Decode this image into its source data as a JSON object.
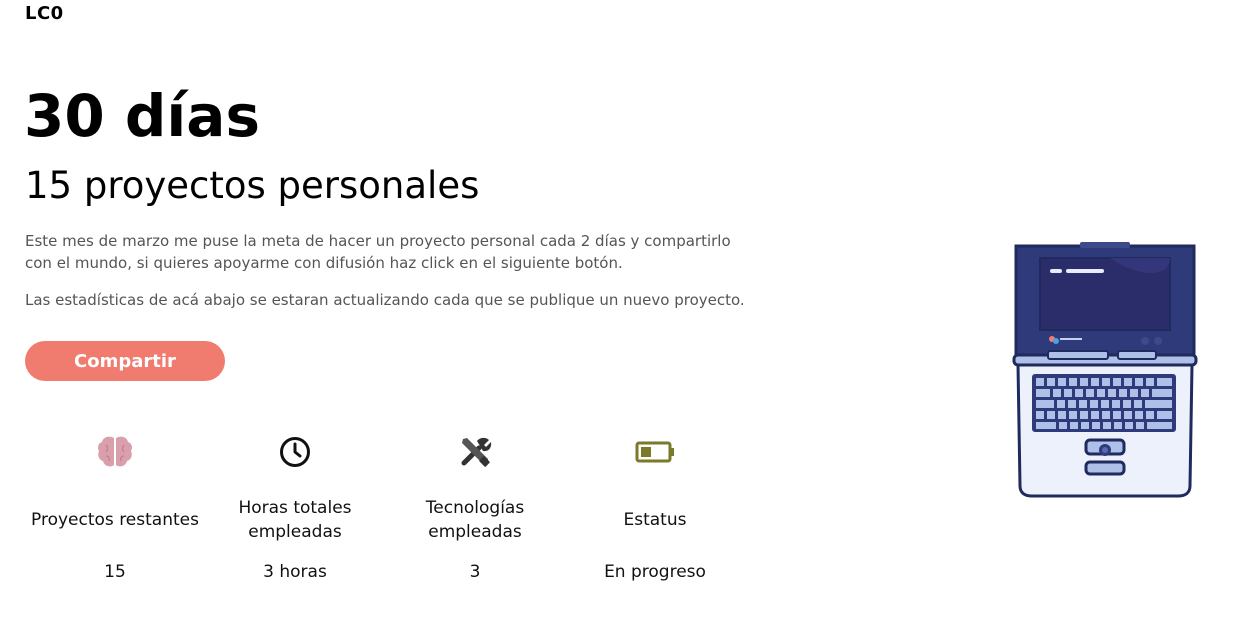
{
  "header": {
    "logo": "LC0"
  },
  "hero": {
    "title": "30 días",
    "subtitle": "15 proyectos personales",
    "description_1": "Este mes de marzo me puse la meta de hacer un proyecto personal cada 2 días y compartirlo con el mundo, si quieres apoyarme con difusión haz click en el siguiente botón.",
    "description_2": "Las estadísticas de acá abajo se estaran actualizando cada que se publique un nuevo proyecto.",
    "share_label": "Compartir"
  },
  "stats": [
    {
      "icon": "brain-icon",
      "label": "Proyectos restantes",
      "value": "15"
    },
    {
      "icon": "clock-icon",
      "label": "Horas totales empleadas",
      "value": "3 horas"
    },
    {
      "icon": "tools-icon",
      "label": "Tecnologías empleadas",
      "value": "3"
    },
    {
      "icon": "battery-icon",
      "label": "Estatus",
      "value": "En progreso"
    }
  ],
  "colors": {
    "accent": "#f07b6f",
    "brain": "#d9a0ac",
    "battery": "#7a7a2a",
    "laptop_body": "#2e3a7a",
    "laptop_screen": "#2a2d6a"
  }
}
